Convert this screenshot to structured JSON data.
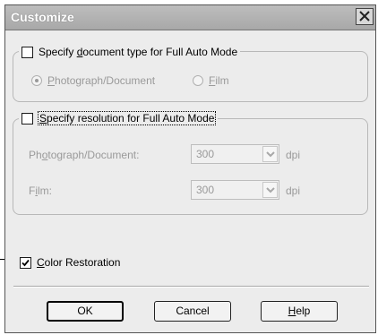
{
  "window": {
    "title": "Customize"
  },
  "doc_type_group": {
    "checkbox_label_pre": "Specify ",
    "checkbox_label_accel": "d",
    "checkbox_label_post": "ocument type for Full Auto Mode",
    "checked": false,
    "options": [
      {
        "label_accel": "P",
        "label_rest": "hotograph/Document",
        "selected": true
      },
      {
        "label_accel": "F",
        "label_rest": "ilm",
        "selected": false
      }
    ]
  },
  "resolution_group": {
    "checkbox_label_accel": "S",
    "checkbox_label_rest": "pecify resolution for Full Auto Mode",
    "checked": false,
    "rows": [
      {
        "label_pre": "Ph",
        "label_accel": "o",
        "label_post": "tograph/Document:",
        "value": "300",
        "unit": "dpi"
      },
      {
        "label_pre": "F",
        "label_accel": "i",
        "label_post": "lm:",
        "value": "300",
        "unit": "dpi"
      }
    ]
  },
  "color_restoration": {
    "label_accel": "C",
    "label_rest": "olor Restoration",
    "checked": true
  },
  "buttons": {
    "ok": "OK",
    "cancel": "Cancel",
    "help_accel": "H",
    "help_rest": "elp"
  },
  "icons": {
    "close": "close-icon",
    "dropdown": "chevron-down-icon",
    "check": "checkmark-icon"
  }
}
